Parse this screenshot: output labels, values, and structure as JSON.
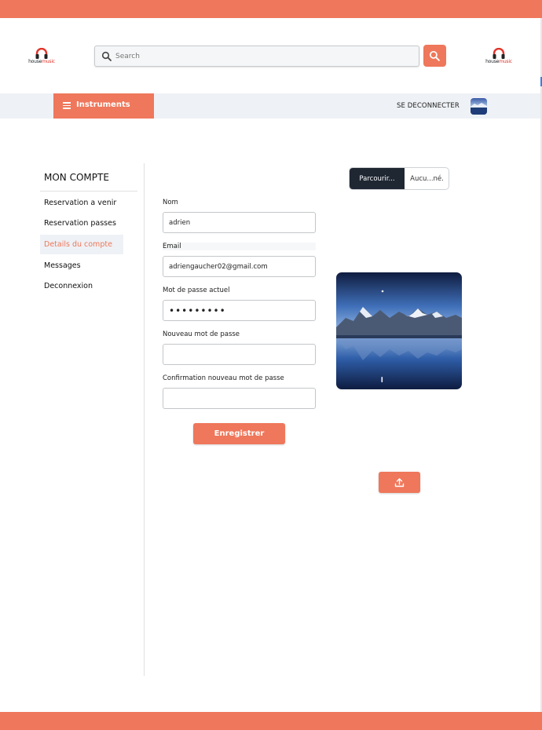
{
  "brand": {
    "logo_text_house": "house",
    "logo_text_music": "music",
    "accent_color": "#ef775b",
    "dark_color": "#1f2733"
  },
  "search": {
    "placeholder": "Search",
    "value": "",
    "search_icon": "search-icon"
  },
  "nav": {
    "menu_label": "Instruments",
    "menu_icon": "hamburger-icon",
    "logout_label": "SE DECONNECTER"
  },
  "sidebar": {
    "title": "MON COMPTE",
    "items": [
      {
        "label": "Reservation a venir",
        "active": false
      },
      {
        "label": "Reservation passes",
        "active": false
      },
      {
        "label": "Details du compte",
        "active": true
      },
      {
        "label": "Messages",
        "active": false
      },
      {
        "label": "Deconnexion",
        "active": false
      }
    ]
  },
  "form": {
    "nom_label": "Nom",
    "nom_value": "adrien",
    "email_label": "Email",
    "email_value": "adriengaucher02@gmail.com",
    "current_password_label": "Mot de passe actuel",
    "current_password_value": "•••••••••",
    "new_password_label": "Nouveau mot de passe",
    "new_password_value": "",
    "confirm_password_label": "Confirmation nouveau mot de passe",
    "confirm_password_value": "",
    "save_label": "Enregistrer"
  },
  "file": {
    "browse_label": "Parcourir...",
    "no_file_label": "Aucu...né."
  },
  "upload": {
    "icon": "upload-icon"
  }
}
